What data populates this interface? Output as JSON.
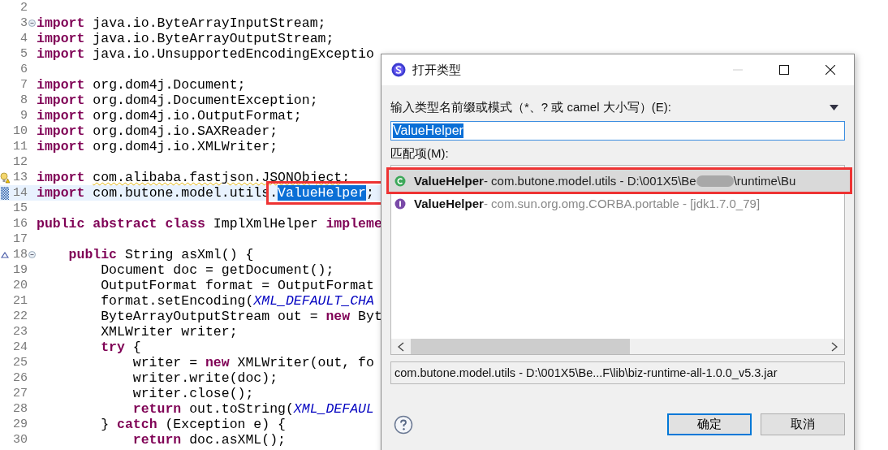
{
  "editor": {
    "lines": [
      {
        "number": "2",
        "current": false
      },
      {
        "number": "3",
        "current": false,
        "gutter_icons": [
          {
            "kind": "fold"
          }
        ],
        "tokens": [
          {
            "kind": "keyword",
            "text": "import"
          },
          {
            "kind": "plain",
            "text": " java.io.ByteArrayInputStream;"
          }
        ]
      },
      {
        "number": "4",
        "current": false,
        "tokens": [
          {
            "kind": "keyword",
            "text": "import"
          },
          {
            "kind": "plain",
            "text": " java.io.ByteArrayOutputStream;"
          }
        ]
      },
      {
        "number": "5",
        "current": false,
        "tokens": [
          {
            "kind": "keyword",
            "text": "import"
          },
          {
            "kind": "plain",
            "text": " java.io.UnsupportedEncodingExceptio"
          }
        ]
      },
      {
        "number": "6",
        "current": false
      },
      {
        "number": "7",
        "current": false,
        "tokens": [
          {
            "kind": "keyword",
            "text": "import"
          },
          {
            "kind": "plain",
            "text": " org.dom4j.Document;"
          }
        ]
      },
      {
        "number": "8",
        "current": false,
        "tokens": [
          {
            "kind": "keyword",
            "text": "import"
          },
          {
            "kind": "plain",
            "text": " org.dom4j.DocumentException;"
          }
        ]
      },
      {
        "number": "9",
        "current": false,
        "tokens": [
          {
            "kind": "keyword",
            "text": "import"
          },
          {
            "kind": "plain",
            "text": " org.dom4j.io.OutputFormat;"
          }
        ]
      },
      {
        "number": "10",
        "current": false,
        "tokens": [
          {
            "kind": "keyword",
            "text": "import"
          },
          {
            "kind": "plain",
            "text": " org.dom4j.io.SAXReader;"
          }
        ]
      },
      {
        "number": "11",
        "current": false,
        "tokens": [
          {
            "kind": "keyword",
            "text": "import"
          },
          {
            "kind": "plain",
            "text": " org.dom4j.io.XMLWriter;"
          }
        ]
      },
      {
        "number": "12",
        "current": false
      },
      {
        "number": "13",
        "current": false,
        "gutter_icons": [
          {
            "kind": "warning"
          }
        ],
        "tokens": [
          {
            "kind": "keyword",
            "text": "import "
          },
          {
            "kind": "warned",
            "text": "com.alibaba.fastjson.JSONObject"
          },
          {
            "kind": "plain",
            "text": ";"
          }
        ]
      },
      {
        "number": "14",
        "current": true,
        "gutter_icons": [
          {
            "kind": "change"
          }
        ],
        "tokens": [
          {
            "kind": "keyword",
            "text": "import"
          },
          {
            "kind": "plain",
            "text": " com.butone.model.utils"
          },
          {
            "kind": "boxed",
            "children": [
              {
                "kind": "plain",
                "text": "."
              },
              {
                "kind": "selected",
                "text": "ValueHelper"
              },
              {
                "kind": "plain",
                "text": ";"
              }
            ]
          }
        ]
      },
      {
        "number": "15",
        "current": false
      },
      {
        "number": "16",
        "current": false,
        "tokens": [
          {
            "kind": "keyword",
            "text": "public abstract class"
          },
          {
            "kind": "plain",
            "text": " ImplXmlHelper "
          },
          {
            "kind": "keyword",
            "text": "impleme"
          }
        ]
      },
      {
        "number": "17",
        "current": false
      },
      {
        "number": "18",
        "current": false,
        "gutter_icons": [
          {
            "kind": "override"
          },
          {
            "kind": "fold"
          }
        ],
        "tokens": [
          {
            "kind": "keyword",
            "text": "    public"
          },
          {
            "kind": "plain",
            "text": " String asXml() {"
          }
        ]
      },
      {
        "number": "19",
        "current": false,
        "tokens": [
          {
            "kind": "plain",
            "text": "        Document doc = getDocument();"
          }
        ]
      },
      {
        "number": "20",
        "current": false,
        "tokens": [
          {
            "kind": "plain",
            "text": "        OutputFormat format = OutputFormat"
          }
        ]
      },
      {
        "number": "21",
        "current": false,
        "tokens": [
          {
            "kind": "plain",
            "text": "        format.setEncoding("
          },
          {
            "kind": "constant",
            "text": "XML_DEFAULT_CHA"
          }
        ]
      },
      {
        "number": "22",
        "current": false,
        "tokens": [
          {
            "kind": "plain",
            "text": "        ByteArrayOutputStream out = "
          },
          {
            "kind": "keyword",
            "text": "new"
          },
          {
            "kind": "plain",
            "text": " Byt"
          }
        ]
      },
      {
        "number": "23",
        "current": false,
        "tokens": [
          {
            "kind": "plain",
            "text": "        XMLWriter writer;"
          }
        ]
      },
      {
        "number": "24",
        "current": false,
        "tokens": [
          {
            "kind": "keyword",
            "text": "        try"
          },
          {
            "kind": "plain",
            "text": " {"
          }
        ]
      },
      {
        "number": "25",
        "current": false,
        "tokens": [
          {
            "kind": "plain",
            "text": "            writer = "
          },
          {
            "kind": "keyword",
            "text": "new"
          },
          {
            "kind": "plain",
            "text": " XMLWriter(out, fo"
          }
        ]
      },
      {
        "number": "26",
        "current": false,
        "tokens": [
          {
            "kind": "plain",
            "text": "            writer.write(doc);"
          }
        ]
      },
      {
        "number": "27",
        "current": false,
        "tokens": [
          {
            "kind": "plain",
            "text": "            writer.close();"
          }
        ]
      },
      {
        "number": "28",
        "current": false,
        "tokens": [
          {
            "kind": "keyword",
            "text": "            return"
          },
          {
            "kind": "plain",
            "text": " out.toString("
          },
          {
            "kind": "constant",
            "text": "XML_DEFAUL"
          }
        ]
      },
      {
        "number": "29",
        "current": false,
        "tokens": [
          {
            "kind": "plain",
            "text": "        } "
          },
          {
            "kind": "keyword",
            "text": "catch"
          },
          {
            "kind": "plain",
            "text": " (Exception e) {"
          }
        ]
      },
      {
        "number": "30",
        "current": false,
        "tokens": [
          {
            "kind": "keyword",
            "text": "            return"
          },
          {
            "kind": "plain",
            "text": " doc.asXML();"
          }
        ]
      }
    ]
  },
  "dialog": {
    "title": "打开类型",
    "pattern_label": "输入类型名前缀或模式（*、? 或 camel 大小写）(E):",
    "pattern_value": "ValueHelper",
    "matches_label": "匹配项(M):",
    "matches": [
      {
        "kind": "class",
        "name": "ValueHelper",
        "detail": " - com.butone.model.utils - D:\\001X5\\Be",
        "blurred": true,
        "detail_after": "\\runtime\\Bu",
        "selected": true,
        "annotated": true
      },
      {
        "kind": "interface",
        "name": "ValueHelper",
        "detail": " - com.sun.org.omg.CORBA.portable - [jdk1.7.0_79]",
        "blurred": false,
        "selected": false,
        "annotated": false
      }
    ],
    "details": "com.butone.model.utils - D:\\001X5\\Be...F\\lib\\biz-runtime-all-1.0.0_v5.3.jar",
    "buttons": [
      {
        "label": "确定",
        "default": true
      },
      {
        "label": "取消",
        "default": false
      }
    ]
  }
}
